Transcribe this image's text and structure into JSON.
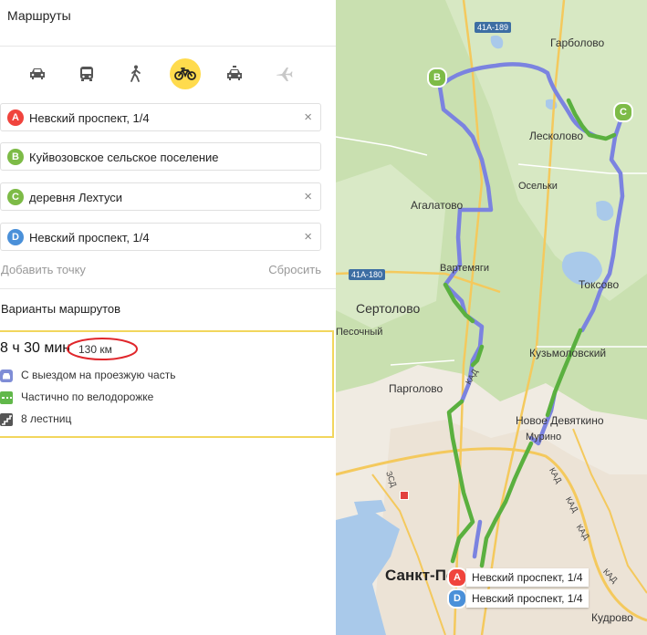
{
  "panel": {
    "title": "Маршруты",
    "modes": [
      {
        "icon": "car-icon",
        "active": false
      },
      {
        "icon": "bus-icon",
        "active": false
      },
      {
        "icon": "pedestrian-icon",
        "active": false
      },
      {
        "icon": "bicycle-icon",
        "active": true
      },
      {
        "icon": "taxi-icon",
        "active": false
      },
      {
        "icon": "airplane-icon",
        "active": false
      }
    ],
    "waypoints": [
      {
        "letter": "A",
        "text": "Невский проспект, 1/4",
        "color": "#f0443d"
      },
      {
        "letter": "B",
        "text": "Куйвозовское сельское поселение",
        "color": "#7dbb47"
      },
      {
        "letter": "C",
        "text": "деревня Лехтуси",
        "color": "#7dbb47"
      },
      {
        "letter": "D",
        "text": "Невский проспект, 1/4",
        "color": "#4a90d9"
      }
    ],
    "clear_symbol": "×",
    "add_point": "Добавить точку",
    "reset": "Сбросить",
    "variants_title": "Варианты маршрутов",
    "route": {
      "time": "8 ч 30 мин",
      "distance": "130 км",
      "features": [
        {
          "icon": "car-road-icon",
          "text": "С выездом на проезжую часть"
        },
        {
          "icon": "bike-lane-icon",
          "text": "Частично по велодорожке"
        },
        {
          "icon": "stairs-icon",
          "text": "8 лестниц"
        }
      ]
    }
  },
  "map": {
    "places": {
      "garbolovo": "Гарболово",
      "leskolovo": "Лесколово",
      "oselki": "Осельки",
      "agalatovo": "Агалатово",
      "vartemyagi": "Вартемяги",
      "sertolovo": "Сертолово",
      "pesochny": "Песочный",
      "toksovo": "Токсово",
      "kuzmolovsky": "Кузьмоловский",
      "pargolovo": "Парголово",
      "novoe_devyatkino": "Новое Девяткино",
      "murino": "Мурино",
      "spb": "Санкт-Петербург",
      "kudrovo": "Кудрово"
    },
    "roads": {
      "r1": "41А-189",
      "r2": "41А-180",
      "kad": "КАД",
      "zsd": "ЗСД"
    },
    "pins": {
      "a": "A",
      "b": "B",
      "c": "C",
      "d": "D"
    },
    "labels": {
      "a": "Невский проспект, 1/4",
      "d": "Невский проспект, 1/4"
    }
  }
}
